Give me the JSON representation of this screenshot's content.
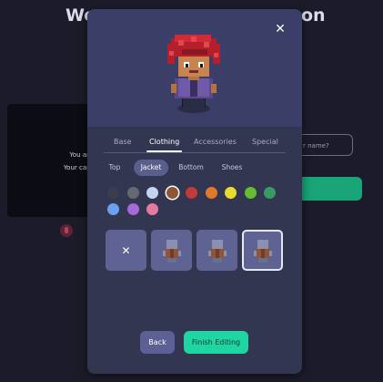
{
  "background": {
    "heading_left": "We",
    "heading_right": "on",
    "video_line1": "You ar",
    "video_line2": "Your car",
    "name_placeholder": "r name?",
    "join_color": "#19a577"
  },
  "modal": {
    "close_icon": "close-icon",
    "main_tabs": [
      {
        "label": "Base"
      },
      {
        "label": "Clothing"
      },
      {
        "label": "Accessories"
      },
      {
        "label": "Special"
      }
    ],
    "main_tab_active": "Clothing",
    "sub_tabs": [
      {
        "label": "Top"
      },
      {
        "label": "Jacket"
      },
      {
        "label": "Bottom"
      },
      {
        "label": "Shoes"
      }
    ],
    "sub_tab_active": "Jacket",
    "colors": [
      "#3b3d4c",
      "#666872",
      "#c2d4ef",
      "#8f5538",
      "#c23a3a",
      "#e07a2a",
      "#ead92e",
      "#66bd2f",
      "#3a9a63",
      "#6aa0ec",
      "#a46ad8",
      "#e57aa0"
    ],
    "selected_color": "#8f5538",
    "items": [
      {
        "kind": "none",
        "icon": "none-x-icon"
      },
      {
        "kind": "jacket",
        "icon": "jacket-variant-1-icon"
      },
      {
        "kind": "jacket",
        "icon": "jacket-variant-2-icon"
      },
      {
        "kind": "jacket",
        "icon": "jacket-variant-3-icon",
        "selected": true
      }
    ],
    "back_label": "Back",
    "finish_label": "Finish Editing",
    "accent_color": "#1fd5a1"
  }
}
